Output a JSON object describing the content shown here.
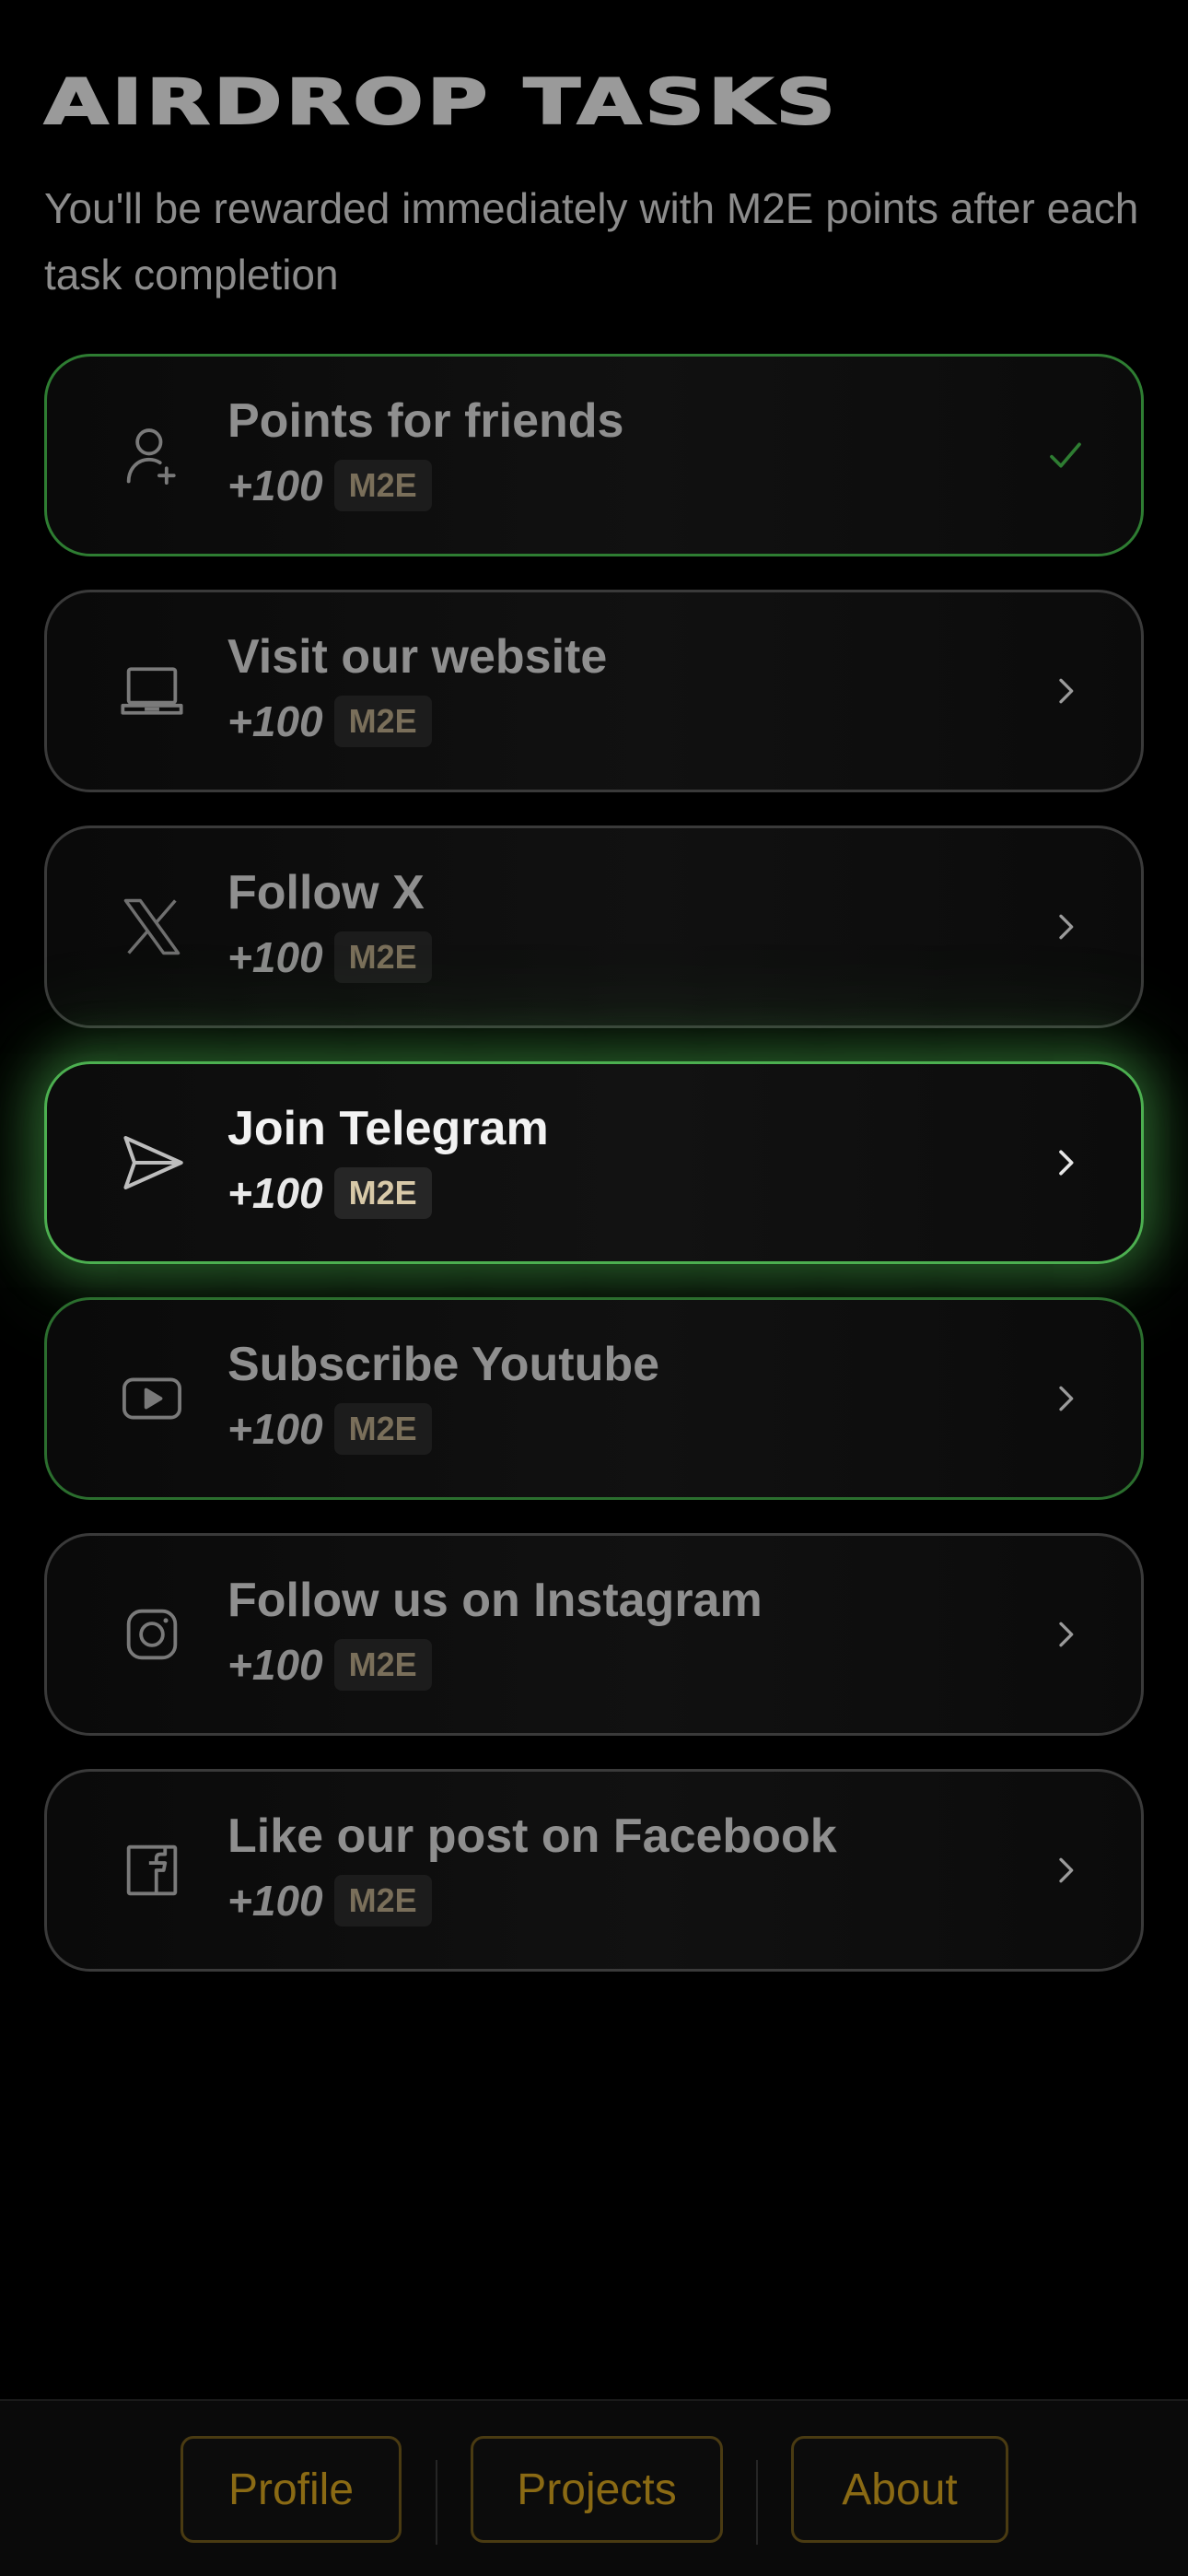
{
  "header": {
    "title": "AIRDROP TASKS",
    "subtitle": "You'll be rewarded immediately with M2E points after each task completion"
  },
  "tasks": [
    {
      "title": "Points for friends",
      "reward": "+100",
      "currency": "M2E",
      "icon": "add-user-icon",
      "status": "completed"
    },
    {
      "title": "Visit our website",
      "reward": "+100",
      "currency": "M2E",
      "icon": "laptop-icon",
      "status": "pending"
    },
    {
      "title": "Follow X",
      "reward": "+100",
      "currency": "M2E",
      "icon": "x-logo-icon",
      "status": "pending"
    },
    {
      "title": "Join Telegram",
      "reward": "+100",
      "currency": "M2E",
      "icon": "telegram-send-icon",
      "status": "highlighted"
    },
    {
      "title": "Subscribe Youtube",
      "reward": "+100",
      "currency": "M2E",
      "icon": "youtube-icon",
      "status": "pending"
    },
    {
      "title": "Follow us on Instagram",
      "reward": "+100",
      "currency": "M2E",
      "icon": "instagram-icon",
      "status": "pending"
    },
    {
      "title": "Like our post on Facebook",
      "reward": "+100",
      "currency": "M2E",
      "icon": "facebook-icon",
      "status": "pending"
    }
  ],
  "nav": {
    "profile": "Profile",
    "projects": "Projects",
    "about": "About"
  },
  "colors": {
    "background": "#000000",
    "accent_green": "#4caf50",
    "nav_gold": "#8a6a14",
    "check_green": "#2e7d32"
  }
}
